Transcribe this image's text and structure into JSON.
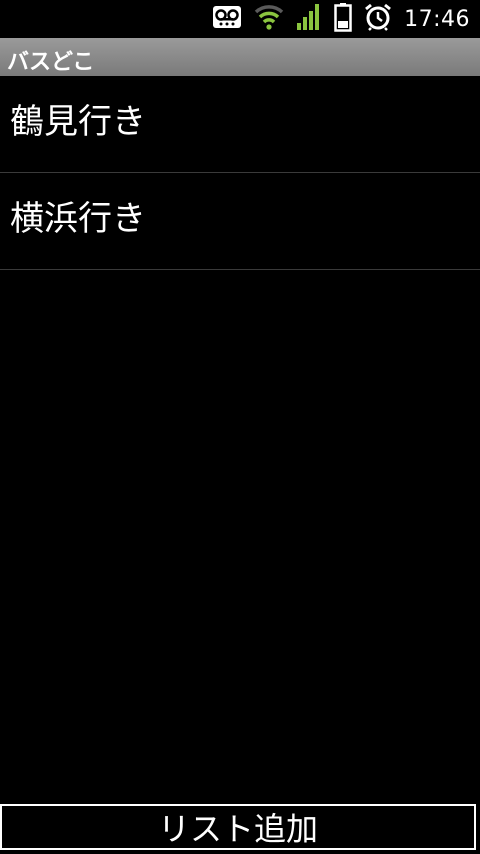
{
  "status_bar": {
    "time": "17:46",
    "icons": [
      "voicemail-icon",
      "wifi-icon",
      "signal-icon",
      "battery-icon",
      "alarm-icon"
    ],
    "colors": {
      "wifi": "#8bc53f",
      "signal": "#8bc53f",
      "icon": "#ffffff"
    }
  },
  "title_bar": {
    "title": "バスどこ"
  },
  "list": {
    "items": [
      {
        "label": "鶴見行き"
      },
      {
        "label": "横浜行き"
      }
    ]
  },
  "footer": {
    "add_button_label": "リスト追加"
  }
}
